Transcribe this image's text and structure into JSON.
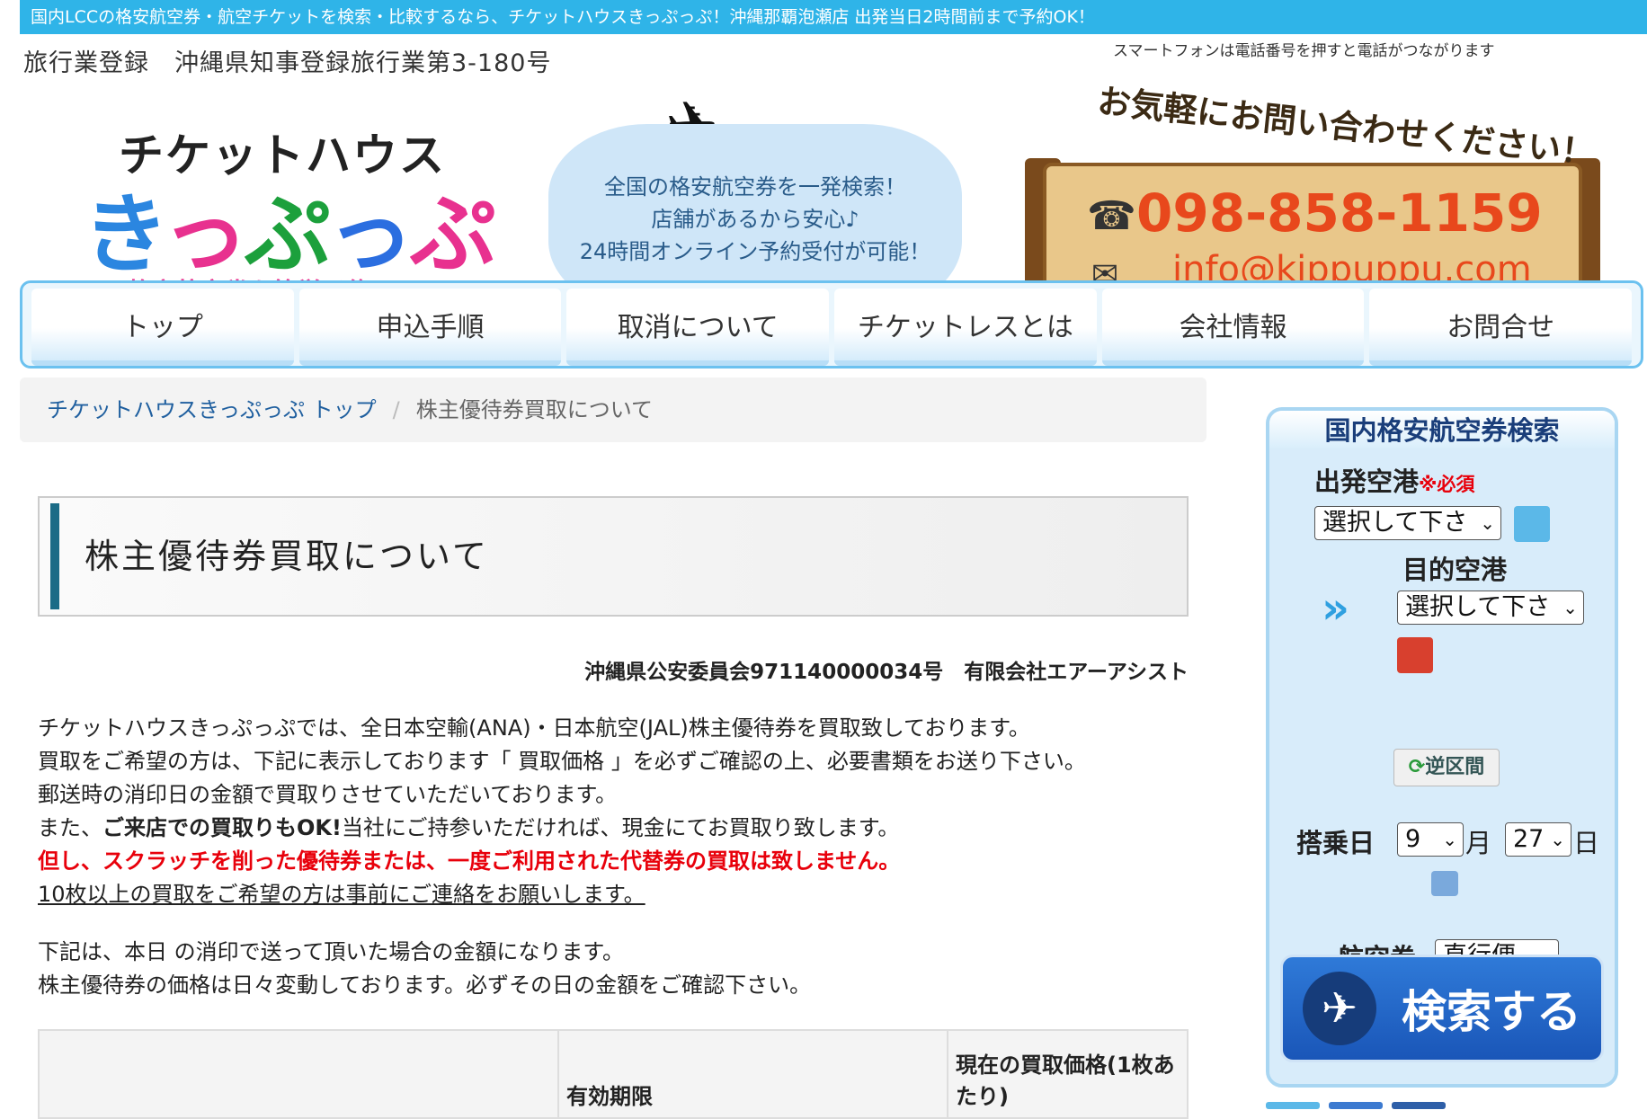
{
  "topbar": {
    "text": "国内LCCの格安航空券・航空チケットを検索・比較するなら、チケットハウスきっぷっぷ！沖縄那覇泡瀬店 出発当日2時間前まで予約OK！"
  },
  "header": {
    "registration": "旅行業登録　沖縄県知事登録旅行業第3-180号",
    "logo_top": "チケットハウス",
    "logo_main": [
      "き",
      "っ",
      "ぷ",
      "っ",
      "ぷ"
    ],
    "logo_tagline": "格安航空券を簡単予約！",
    "cloud_lines": [
      "全国の格安航空券を一発検索！",
      "店舗があるから安心♪",
      "24時間オンライン予約受付が可能！"
    ],
    "smartphone_note": "スマートフォンは電話番号を押すと電話がつながります",
    "board_banner": "お気軽にお問い合わせください！",
    "phone": "098-858-1159",
    "email": "info@kippuppu.com"
  },
  "nav": {
    "items": [
      "トップ",
      "申込手順",
      "取消について",
      "チケットレスとは",
      "会社情報",
      "お問合せ"
    ]
  },
  "breadcrumb": {
    "home": "チケットハウスきっぷっぷ トップ",
    "separator": "/",
    "current": "株主優待券買取について"
  },
  "main": {
    "title": "株主優待券買取について",
    "company_line": "沖縄県公安委員会971140000034号　有限会社エアーアシスト",
    "para1": "チケットハウスきっぷっぷでは、全日本空輸(ANA)・日本航空(JAL)株主優待券を買取致しております。",
    "para2": "買取をご希望の方は、下記に表示しております「 買取価格 」を必ずご確認の上、必要書類をお送り下さい。",
    "para3": "郵送時の消印日の金額で買取りさせていただいております。",
    "para4_a": "また、",
    "para4_b": "ご来店での買取りもOK!",
    "para4_c": "当社にご持参いただければ、現金にてお買取り致します。",
    "warning": "但し、スクラッチを削った優待券または、一度ご利用された代替券の買取は致しません。",
    "notice": "10枚以上の買取をご希望の方は事前にご連絡をお願いします。",
    "para5": "下記は、本日 の消印で送って頂いた場合の金額になります。",
    "para6": "株主優待券の価格は日々変動しております。必ずその日の金額をご確認下さい。",
    "table": {
      "col1": "",
      "col2": "有効期限",
      "col3_line1": "現在の買取価格(1枚あ",
      "col3_line2": "たり)"
    }
  },
  "sidebar": {
    "title": "国内格安航空券検索",
    "departure_label": "出発空港",
    "required": "※必須",
    "departure_value": "選択して下さ",
    "destination_label": "目的空港",
    "destination_value": "選択して下さ",
    "reverse_label": "逆区間",
    "date_label": "搭乗日",
    "month_value": "9",
    "month_unit": "月",
    "day_value": "27",
    "day_unit": "日",
    "ticket_label": "航空券",
    "ticket_value": "直行便",
    "search_label": "検索する"
  },
  "colors": {
    "accent_blue": "#2fb4e8",
    "warning_red": "#e8000b",
    "phone_orange": "#e8481c"
  }
}
